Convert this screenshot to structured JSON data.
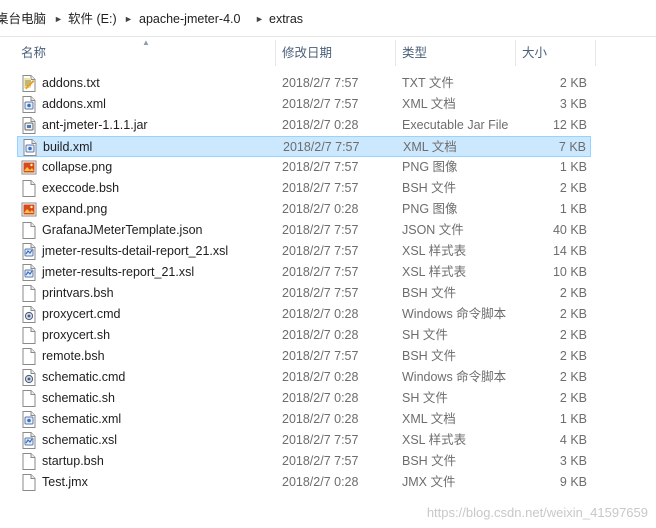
{
  "breadcrumb": [
    "桌台电脑",
    "软件 (E:)",
    "apache-jmeter-4.0",
    "extras"
  ],
  "columns": {
    "name": "名称",
    "date": "修改日期",
    "type": "类型",
    "size": "大小"
  },
  "files": [
    {
      "name": "addons.txt",
      "date": "2018/2/7 7:57",
      "type": "TXT 文件",
      "size": "2 KB",
      "icon": "txt-file-icon"
    },
    {
      "name": "addons.xml",
      "date": "2018/2/7 7:57",
      "type": "XML 文档",
      "size": "3 KB",
      "icon": "xml-file-icon"
    },
    {
      "name": "ant-jmeter-1.1.1.jar",
      "date": "2018/2/7 0:28",
      "type": "Executable Jar File",
      "size": "12 KB",
      "icon": "jar-file-icon"
    },
    {
      "name": "build.xml",
      "date": "2018/2/7 7:57",
      "type": "XML 文档",
      "size": "7 KB",
      "icon": "xml-file-icon",
      "selected": true
    },
    {
      "name": "collapse.png",
      "date": "2018/2/7 7:57",
      "type": "PNG 图像",
      "size": "1 KB",
      "icon": "image-file-icon"
    },
    {
      "name": "execcode.bsh",
      "date": "2018/2/7 7:57",
      "type": "BSH 文件",
      "size": "2 KB",
      "icon": "blank-file-icon"
    },
    {
      "name": "expand.png",
      "date": "2018/2/7 0:28",
      "type": "PNG 图像",
      "size": "1 KB",
      "icon": "image-file-icon"
    },
    {
      "name": "GrafanaJMeterTemplate.json",
      "date": "2018/2/7 7:57",
      "type": "JSON 文件",
      "size": "40 KB",
      "icon": "blank-file-icon"
    },
    {
      "name": "jmeter-results-detail-report_21.xsl",
      "date": "2018/2/7 7:57",
      "type": "XSL 样式表",
      "size": "14 KB",
      "icon": "xsl-file-icon"
    },
    {
      "name": "jmeter-results-report_21.xsl",
      "date": "2018/2/7 7:57",
      "type": "XSL 样式表",
      "size": "10 KB",
      "icon": "xsl-file-icon"
    },
    {
      "name": "printvars.bsh",
      "date": "2018/2/7 7:57",
      "type": "BSH 文件",
      "size": "2 KB",
      "icon": "blank-file-icon"
    },
    {
      "name": "proxycert.cmd",
      "date": "2018/2/7 0:28",
      "type": "Windows 命令脚本",
      "size": "2 KB",
      "icon": "cmd-file-icon"
    },
    {
      "name": "proxycert.sh",
      "date": "2018/2/7 0:28",
      "type": "SH 文件",
      "size": "2 KB",
      "icon": "blank-file-icon"
    },
    {
      "name": "remote.bsh",
      "date": "2018/2/7 7:57",
      "type": "BSH 文件",
      "size": "2 KB",
      "icon": "blank-file-icon"
    },
    {
      "name": "schematic.cmd",
      "date": "2018/2/7 0:28",
      "type": "Windows 命令脚本",
      "size": "2 KB",
      "icon": "cmd-file-icon"
    },
    {
      "name": "schematic.sh",
      "date": "2018/2/7 0:28",
      "type": "SH 文件",
      "size": "2 KB",
      "icon": "blank-file-icon"
    },
    {
      "name": "schematic.xml",
      "date": "2018/2/7 0:28",
      "type": "XML 文档",
      "size": "1 KB",
      "icon": "xml-file-icon"
    },
    {
      "name": "schematic.xsl",
      "date": "2018/2/7 7:57",
      "type": "XSL 样式表",
      "size": "4 KB",
      "icon": "xsl-file-icon"
    },
    {
      "name": "startup.bsh",
      "date": "2018/2/7 7:57",
      "type": "BSH 文件",
      "size": "3 KB",
      "icon": "blank-file-icon"
    },
    {
      "name": "Test.jmx",
      "date": "2018/2/7 0:28",
      "type": "JMX 文件",
      "size": "9 KB",
      "icon": "blank-file-icon"
    }
  ],
  "watermark": "https://blog.csdn.net/weixin_41597659",
  "colors": {
    "selection_bg": "#cce8ff",
    "selection_border": "#99d1ff",
    "header_text": "#4c607a",
    "meta_text": "#6d6d6d"
  }
}
